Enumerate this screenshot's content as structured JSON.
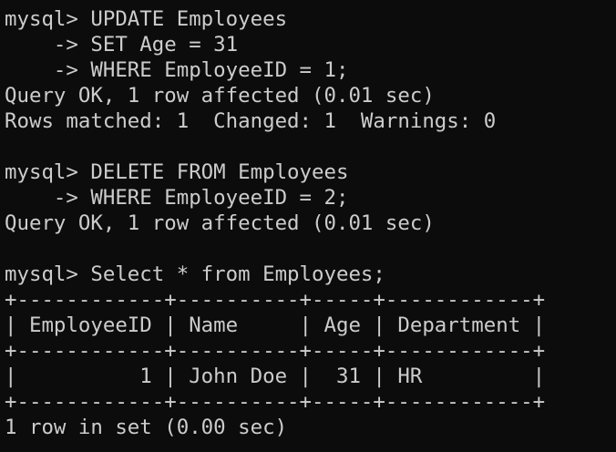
{
  "terminal": {
    "lines": [
      "mysql> UPDATE Employees",
      "    -> SET Age = 31",
      "    -> WHERE EmployeeID = 1;",
      "Query OK, 1 row affected (0.01 sec)",
      "Rows matched: 1  Changed: 1  Warnings: 0",
      "",
      "mysql> DELETE FROM Employees",
      "    -> WHERE EmployeeID = 2;",
      "Query OK, 1 row affected (0.01 sec)",
      "",
      "mysql> Select * from Employees;",
      "+------------+----------+-----+------------+",
      "| EmployeeID | Name     | Age | Department |",
      "+------------+----------+-----+------------+",
      "|          1 | John Doe |  31 | HR         |",
      "+------------+----------+-----+------------+",
      "1 row in set (0.00 sec)"
    ]
  },
  "colors": {
    "background": "#0c0c0c",
    "text": "#cccccc"
  }
}
